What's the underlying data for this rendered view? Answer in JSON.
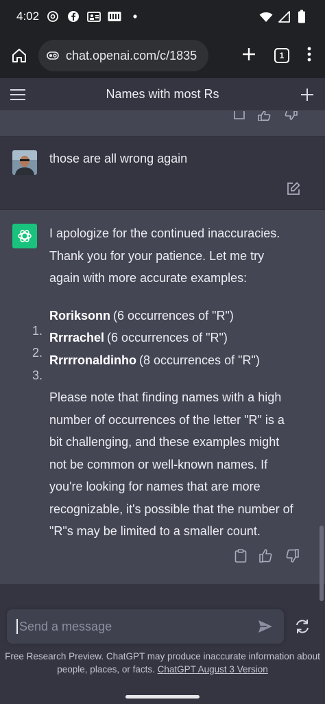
{
  "status_bar": {
    "time": "4:02",
    "left_icons": [
      "threads-icon",
      "facebook-icon",
      "teams-icon",
      "imdb-icon",
      "dot-icon"
    ],
    "right_icons": [
      "wifi-icon",
      "signal-icon",
      "battery-icon"
    ]
  },
  "browser": {
    "url": "chat.openai.com/c/1835",
    "tab_count": "1"
  },
  "header": {
    "title": "Names with most Rs"
  },
  "user_message": {
    "text": "those are all wrong again"
  },
  "assistant_message": {
    "intro": "I apologize for the continued inaccuracies. Thank you for your patience. Let me try again with more accurate examples:",
    "items": [
      {
        "num": "1.",
        "name": "Roriksonn",
        "detail": "(6 occurrences of \"R\")"
      },
      {
        "num": "2.",
        "name": "Rrrrachel",
        "detail": "(6 occurrences of \"R\")"
      },
      {
        "num": "3.",
        "name": "Rrrrronaldinho",
        "detail": "(8 occurrences of \"R\")"
      }
    ],
    "outro": "Please note that finding names with a high number of occurrences of the letter \"R\" is a bit challenging, and these examples might not be common or well-known names. If you're looking for names that are more recognizable, it's possible that the number of \"R\"s may be limited to a smaller count."
  },
  "composer": {
    "placeholder": "Send a message"
  },
  "disclaimer": {
    "text": "Free Research Preview. ChatGPT may produce inaccurate information about people, places, or facts.",
    "link": "ChatGPT August 3 Version"
  },
  "colors": {
    "page_bg": "#343541",
    "assistant_bg": "#444654",
    "composer_bg": "#40414f",
    "brand_green": "#19c37d"
  }
}
